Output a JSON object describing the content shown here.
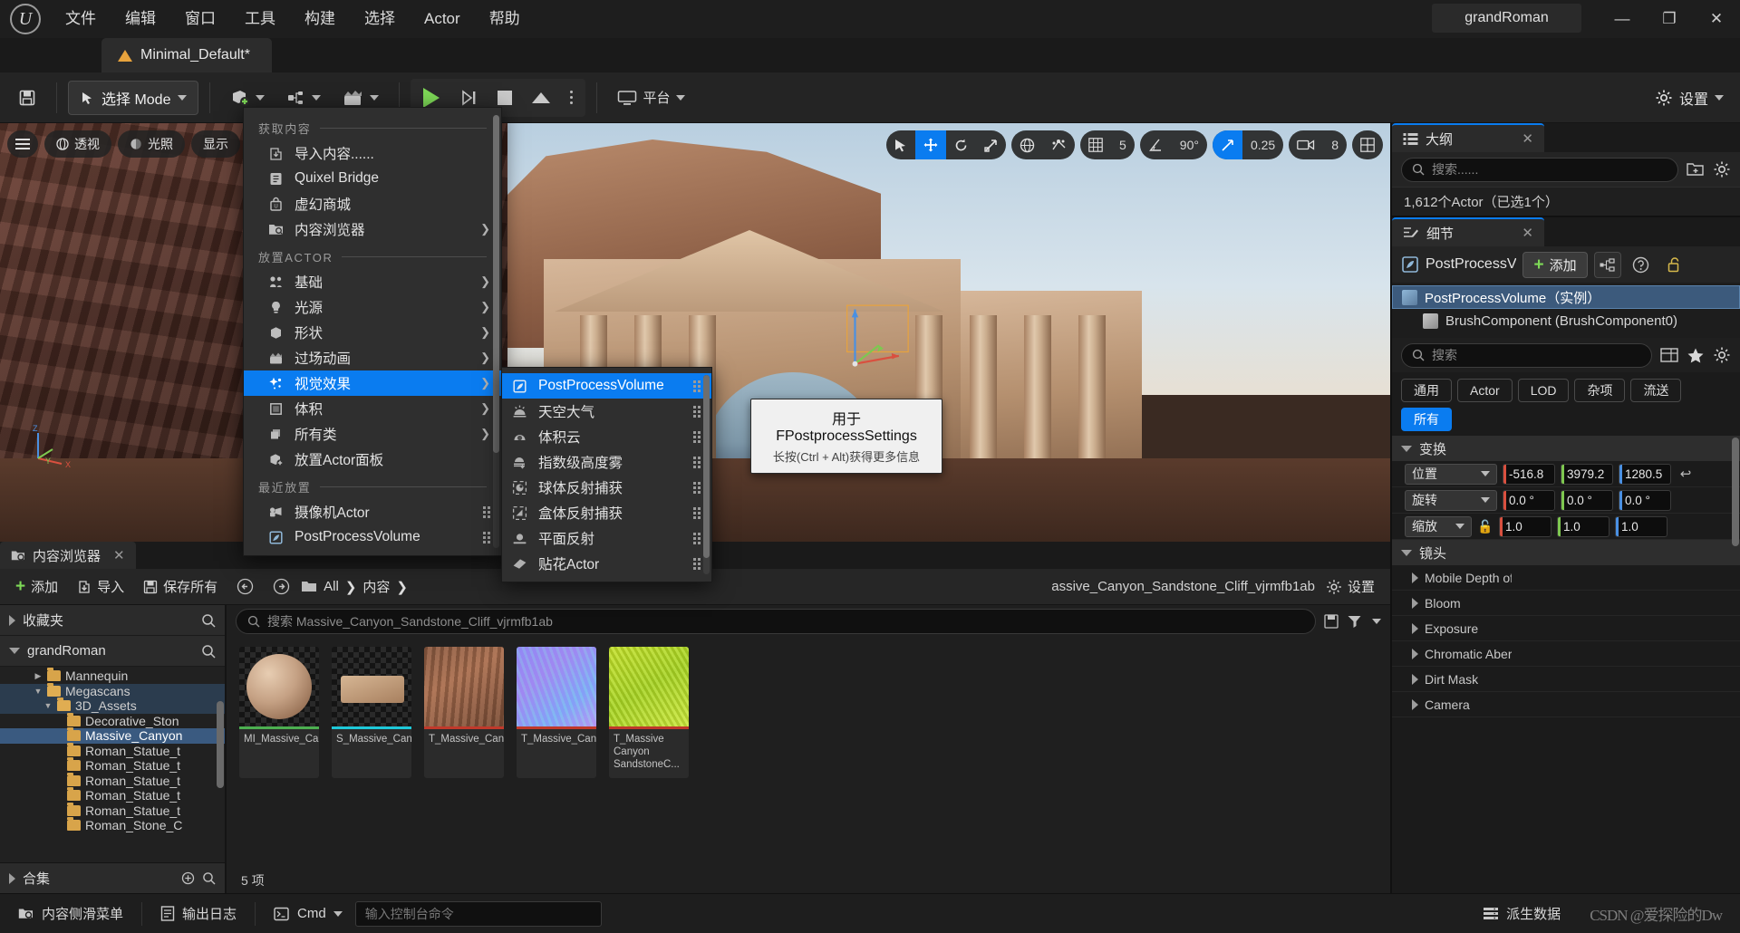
{
  "titlebar": {
    "logo": "ue-logo",
    "menus": [
      "文件",
      "编辑",
      "窗口",
      "工具",
      "构建",
      "选择",
      "Actor",
      "帮助"
    ],
    "project_name": "grandRoman",
    "window_buttons": [
      "minimize",
      "maximize",
      "close"
    ]
  },
  "level_tab": {
    "label": "Minimal_Default*"
  },
  "toolbar": {
    "save_icon": "save-icon",
    "mode_label": "选择 Mode",
    "create_icon": "create-actor-icon",
    "blueprint_icon": "blueprint-icon",
    "cinematics_icon": "cinematics-icon",
    "play_icon": "play-icon",
    "skip_icon": "step-icon",
    "stop_icon": "stop-icon",
    "eject_icon": "eject-icon",
    "more_icon": "more-options-icon",
    "platforms_label": "平台",
    "settings_label": "设置"
  },
  "viewport": {
    "menu_icon": "viewport-menu-icon",
    "perspective_label": "透视",
    "lighting_label": "光照",
    "show_label": "显示",
    "tools": [
      {
        "name": "select-tool",
        "glyph": "➤",
        "active": false
      },
      {
        "name": "move-tool",
        "glyph": "✥",
        "active": true
      },
      {
        "name": "rotate-tool",
        "glyph": "⟳",
        "active": false
      },
      {
        "name": "scale-tool",
        "glyph": "⤢",
        "active": false
      }
    ],
    "coord_icon": "world-coordinate-icon",
    "snap_icon": "surface-snap-icon",
    "grid_icon": "grid-snap-icon",
    "grid_value": "5",
    "angle_icon": "angle-snap-icon",
    "angle_value": "90°",
    "scale_snap_icon": "scale-snap-icon",
    "scale_value": "0.25",
    "camera_icon": "camera-speed-icon",
    "camera_value": "8",
    "layout_icon": "viewport-layout-icon"
  },
  "add_menu": {
    "sections": [
      {
        "title": "获取内容",
        "items": [
          {
            "label": "导入内容......",
            "icon": "import-icon",
            "submenu": false
          },
          {
            "label": "Quixel Bridge",
            "icon": "bridge-icon",
            "submenu": false
          },
          {
            "label": "虚幻商城",
            "icon": "marketplace-icon",
            "submenu": false
          },
          {
            "label": "内容浏览器",
            "icon": "content-browser-icon",
            "submenu": true
          }
        ]
      },
      {
        "title": "放置ACTOR",
        "items": [
          {
            "label": "基础",
            "icon": "basic-icon",
            "submenu": true
          },
          {
            "label": "光源",
            "icon": "light-icon",
            "submenu": true
          },
          {
            "label": "形状",
            "icon": "shape-icon",
            "submenu": true
          },
          {
            "label": "过场动画",
            "icon": "cinematic-icon",
            "submenu": true
          },
          {
            "label": "视觉效果",
            "icon": "visual-effects-icon",
            "submenu": true,
            "highlighted": true
          },
          {
            "label": "体积",
            "icon": "volume-icon",
            "submenu": true
          },
          {
            "label": "所有类",
            "icon": "all-classes-icon",
            "submenu": true
          },
          {
            "label": "放置Actor面板",
            "icon": "place-actor-panel-icon",
            "submenu": false
          }
        ]
      },
      {
        "title": "最近放置",
        "items": [
          {
            "label": "摄像机Actor",
            "icon": "camera-actor-icon",
            "submenu": false,
            "grip": true
          },
          {
            "label": "PostProcessVolume",
            "icon": "postprocess-icon",
            "submenu": false,
            "grip": true
          }
        ]
      }
    ]
  },
  "vfx_submenu": {
    "items": [
      {
        "label": "PostProcessVolume",
        "icon": "postprocess-volume-icon",
        "highlighted": true
      },
      {
        "label": "天空大气",
        "icon": "sky-atmosphere-icon",
        "highlighted": false
      },
      {
        "label": "体积云",
        "icon": "volumetric-cloud-icon",
        "highlighted": false
      },
      {
        "label": "指数级高度雾",
        "icon": "exponential-height-fog-icon",
        "highlighted": false
      },
      {
        "label": "球体反射捕获",
        "icon": "sphere-reflection-capture-icon",
        "highlighted": false
      },
      {
        "label": "盒体反射捕获",
        "icon": "box-reflection-capture-icon",
        "highlighted": false
      },
      {
        "label": "平面反射",
        "icon": "planar-reflection-icon",
        "highlighted": false
      },
      {
        "label": "贴花Actor",
        "icon": "decal-actor-icon",
        "highlighted": false
      }
    ]
  },
  "tooltip": {
    "title": "用于FPostprocessSettings",
    "hint": "长按(Ctrl + Alt)获得更多信息"
  },
  "content_browser": {
    "tab_label": "内容浏览器",
    "add_label": "添加",
    "import_label": "导入",
    "save_all_label": "保存所有",
    "back_icon": "back-arrow-icon",
    "forward_icon": "forward-arrow-icon",
    "breadcrumb": [
      "All",
      "内容"
    ],
    "settings_label": "设置",
    "favorites_label": "收藏夹",
    "project_root": "grandRoman",
    "tree": [
      {
        "label": "Mannequin",
        "depth": 3,
        "state": "collapsed"
      },
      {
        "label": "Megascans",
        "depth": 3,
        "state": "expanded",
        "highlight": "soft"
      },
      {
        "label": "3D_Assets",
        "depth": 4,
        "state": "expanded",
        "highlight": "soft"
      },
      {
        "label": "Decorative_Ston",
        "depth": 5,
        "state": "leaf"
      },
      {
        "label": "Massive_Canyon",
        "depth": 5,
        "state": "leaf",
        "highlight": "selected"
      },
      {
        "label": "Roman_Statue_t",
        "depth": 5,
        "state": "leaf"
      },
      {
        "label": "Roman_Statue_t",
        "depth": 5,
        "state": "leaf"
      },
      {
        "label": "Roman_Statue_t",
        "depth": 5,
        "state": "leaf"
      },
      {
        "label": "Roman_Statue_t",
        "depth": 5,
        "state": "leaf"
      },
      {
        "label": "Roman_Statue_t",
        "depth": 5,
        "state": "leaf"
      },
      {
        "label": "Roman_Stone_C",
        "depth": 5,
        "state": "leaf"
      }
    ],
    "collections_label": "合集",
    "search_value": "搜索 Massive_Canyon_Sandstone_Cliff_vjrmfb1ab",
    "assets": [
      {
        "name": "MI_Massive_Canyon_Sandstone_...Cliff",
        "type": "material-instance",
        "bar_color": "#4caf50"
      },
      {
        "name": "S_Massive_Canyon_Sandstone_...Cliff",
        "type": "static-mesh",
        "bar_color": "#1ec8d8"
      },
      {
        "name": "T_Massive_Canyon_Sandstone_...Cliff",
        "type": "texture-albedo",
        "bar_color": "#c0392b"
      },
      {
        "name": "T_Massive_Canyon_Sandstone_...Cliff",
        "type": "texture-normal",
        "bar_color": "#c0392b"
      },
      {
        "name": "T_Massive Canyon SandstoneC...",
        "type": "texture-roughness",
        "bar_color": "#c0392b"
      }
    ],
    "item_count": "5 项"
  },
  "outliner": {
    "tab_label": "大纲",
    "search_placeholder": "搜索......",
    "new_folder_icon": "new-folder-icon",
    "settings_icon": "gear-icon",
    "actor_count": "1,612个Actor（已选1个）"
  },
  "details": {
    "tab_label": "细节",
    "actor_name": "PostProcessV",
    "add_label": "添加",
    "components_icon": "components-icon",
    "help_icon": "help-icon",
    "lock_icon": "unlock-icon",
    "components": [
      {
        "label": "PostProcessVolume（实例）",
        "icon": "volume-cube-icon",
        "selected": true
      },
      {
        "label": "BrushComponent (BrushComponent0)",
        "icon": "brush-cube-icon",
        "selected": false
      }
    ],
    "search_placeholder": "搜索",
    "column_icon": "column-layout-icon",
    "favorite_icon": "star-icon",
    "settings_icon": "gear-icon",
    "filters": [
      "通用",
      "Actor",
      "LOD",
      "杂项",
      "流送"
    ],
    "filter_all": "所有",
    "transform": {
      "section_label": "变换",
      "rows": [
        {
          "label": "位置",
          "values": [
            "-516.8",
            "3979.2",
            "1280.5"
          ],
          "reset": true,
          "lock": false
        },
        {
          "label": "旋转",
          "values": [
            "0.0 °",
            "0.0 °",
            "0.0 °"
          ],
          "reset": false,
          "lock": false
        },
        {
          "label": "缩放",
          "values": [
            "1.0",
            "1.0",
            "1.0"
          ],
          "reset": false,
          "lock": true
        }
      ]
    },
    "lens": {
      "section_label": "镜头",
      "rows": [
        "Mobile Depth of Field",
        "Bloom",
        "Exposure",
        "Chromatic Aberration",
        "Dirt Mask",
        "Camera"
      ]
    }
  },
  "statusbar": {
    "content_drawer_label": "内容侧滑菜单",
    "output_log_label": "输出日志",
    "cmd_label": "Cmd",
    "console_placeholder": "输入控制台命令",
    "derived_data_label": "派生数据",
    "watermark": "CSDN @爱探险的Dw"
  },
  "colors": {
    "accent": "#0a7cf0",
    "green": "#7ed957",
    "folder": "#d8a44a",
    "axis_x": "#d9503f",
    "axis_y": "#7ec850",
    "axis_z": "#4a90e2"
  }
}
